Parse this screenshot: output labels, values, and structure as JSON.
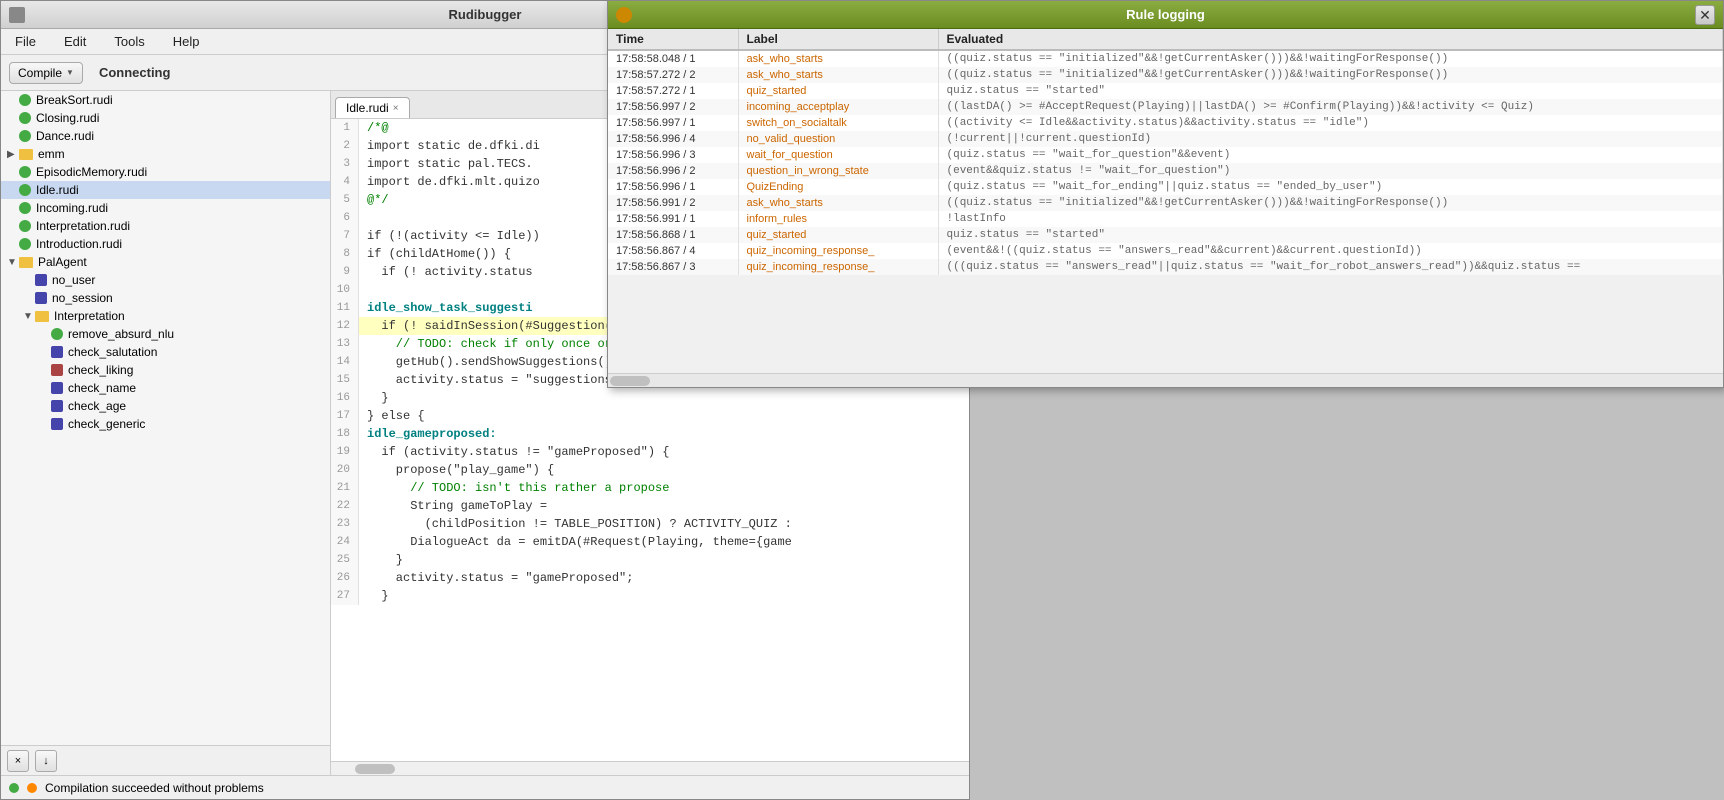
{
  "mainWindow": {
    "title": "Rudibugger",
    "menu": [
      "File",
      "Edit",
      "Tools",
      "Help"
    ],
    "toolbar": {
      "compile_label": "Compile",
      "connecting_label": "Connecting"
    }
  },
  "sidebar": {
    "items": [
      {
        "label": "BreakSort.rudi",
        "icon": "green",
        "indent": 0,
        "type": "file"
      },
      {
        "label": "Closing.rudi",
        "icon": "green",
        "indent": 0,
        "type": "file"
      },
      {
        "label": "Dance.rudi",
        "icon": "green",
        "indent": 0,
        "type": "file"
      },
      {
        "label": "emm",
        "icon": "folder",
        "indent": 0,
        "type": "folder",
        "expanded": false
      },
      {
        "label": "EpisodicMemory.rudi",
        "icon": "green",
        "indent": 0,
        "type": "file"
      },
      {
        "label": "Idle.rudi",
        "icon": "green",
        "indent": 0,
        "type": "file",
        "selected": true
      },
      {
        "label": "Incoming.rudi",
        "icon": "green",
        "indent": 0,
        "type": "file"
      },
      {
        "label": "Interpretation.rudi",
        "icon": "green",
        "indent": 0,
        "type": "file"
      },
      {
        "label": "Introduction.rudi",
        "icon": "green",
        "indent": 0,
        "type": "file"
      },
      {
        "label": "PalAgent",
        "icon": "folder",
        "indent": 0,
        "type": "folder",
        "expanded": true
      },
      {
        "label": "no_user",
        "icon": "blue-sq",
        "indent": 1,
        "type": "file"
      },
      {
        "label": "no_session",
        "icon": "blue-sq",
        "indent": 1,
        "type": "file"
      },
      {
        "label": "Interpretation",
        "icon": "folder",
        "indent": 1,
        "type": "folder",
        "expanded": true
      },
      {
        "label": "remove_absurd_nlu",
        "icon": "green",
        "indent": 2,
        "type": "file"
      },
      {
        "label": "check_salutation",
        "icon": "blue-sq",
        "indent": 2,
        "type": "file"
      },
      {
        "label": "check_liking",
        "icon": "red-sq",
        "indent": 2,
        "type": "file"
      },
      {
        "label": "check_name",
        "icon": "blue-sq",
        "indent": 2,
        "type": "file"
      },
      {
        "label": "check_age",
        "icon": "blue-sq",
        "indent": 2,
        "type": "file"
      },
      {
        "label": "check_generic",
        "icon": "blue-sq",
        "indent": 2,
        "type": "file"
      }
    ]
  },
  "editor": {
    "tab": "Idle.rudi",
    "lines": [
      {
        "num": 1,
        "content": "/*@",
        "cls": "c-comment",
        "highlight": false
      },
      {
        "num": 2,
        "content": "import static de.dfki.di",
        "cls": "c-normal",
        "highlight": false
      },
      {
        "num": 3,
        "content": "import static pal.TECS.",
        "cls": "c-normal",
        "highlight": false
      },
      {
        "num": 4,
        "content": "import de.dfki.mlt.quizo",
        "cls": "c-normal",
        "highlight": false
      },
      {
        "num": 5,
        "content": "@*/",
        "cls": "c-comment",
        "highlight": false
      },
      {
        "num": 6,
        "content": "",
        "cls": "c-normal",
        "highlight": false
      },
      {
        "num": 7,
        "content": "if (!(activity <= Idle))",
        "cls": "c-normal",
        "highlight": false
      },
      {
        "num": 8,
        "content": "if (childAtHome()) {",
        "cls": "c-normal",
        "highlight": false
      },
      {
        "num": 9,
        "content": "  if (! activity.status",
        "cls": "c-normal",
        "highlight": false
      },
      {
        "num": 10,
        "content": "",
        "cls": "c-normal",
        "highlight": false
      },
      {
        "num": 11,
        "content": "idle_show_task_suggesti",
        "cls": "c-label",
        "highlight": false
      },
      {
        "num": 12,
        "content": "  if (! saidInSession(#Suggestion(Task)) && activity.status",
        "cls": "c-normal",
        "highlight": true
      },
      {
        "num": 13,
        "content": "    // TODO: check if only once or every time you go to hom",
        "cls": "c-comment",
        "highlight": false
      },
      {
        "num": 14,
        "content": "    getHub().sendShowSuggestions();",
        "cls": "c-normal",
        "highlight": false
      },
      {
        "num": 15,
        "content": "    activity.status = \"suggestions_requested\";",
        "cls": "c-normal",
        "highlight": false
      },
      {
        "num": 16,
        "content": "  }",
        "cls": "c-normal",
        "highlight": false
      },
      {
        "num": 17,
        "content": "} else {",
        "cls": "c-normal",
        "highlight": false
      },
      {
        "num": 18,
        "content": "idle_gameproposed:",
        "cls": "c-label",
        "highlight": false
      },
      {
        "num": 19,
        "content": "  if (activity.status != \"gameProposed\") {",
        "cls": "c-normal",
        "highlight": false
      },
      {
        "num": 20,
        "content": "    propose(\"play_game\") {",
        "cls": "c-normal",
        "highlight": false
      },
      {
        "num": 21,
        "content": "      // TODO: isn't this rather a propose",
        "cls": "c-comment",
        "highlight": false
      },
      {
        "num": 22,
        "content": "      String gameToPlay =",
        "cls": "c-normal",
        "highlight": false
      },
      {
        "num": 23,
        "content": "        (childPosition != TABLE_POSITION) ? ACTIVITY_QUIZ :",
        "cls": "c-normal",
        "highlight": false
      },
      {
        "num": 24,
        "content": "      DialogueAct da = emitDA(#Request(Playing, theme={game",
        "cls": "c-normal",
        "highlight": false
      },
      {
        "num": 25,
        "content": "    }",
        "cls": "c-normal",
        "highlight": false
      },
      {
        "num": 26,
        "content": "    activity.status = \"gameProposed\";",
        "cls": "c-normal",
        "highlight": false
      },
      {
        "num": 27,
        "content": "  }",
        "cls": "c-normal",
        "highlight": false
      }
    ]
  },
  "statusBar": {
    "message": "Compilation succeeded without problems"
  },
  "ruleLogging": {
    "title": "Rule logging",
    "columns": [
      "Time",
      "Label",
      "Evaluated"
    ],
    "rows": [
      {
        "time": "17:58:58.048 / 1",
        "label": "ask_who_starts",
        "eval": "((quiz.status == \"initialized\"&&!getCurrentAsker()))&&!waitingForResponse())"
      },
      {
        "time": "17:58:57.272 / 2",
        "label": "ask_who_starts",
        "eval": "((quiz.status == \"initialized\"&&!getCurrentAsker()))&&!waitingForResponse())"
      },
      {
        "time": "17:58:57.272 / 1",
        "label": "quiz_started",
        "eval": "quiz.status == \"started\""
      },
      {
        "time": "17:58:56.997 / 2",
        "label": "incoming_acceptplay",
        "eval": "((lastDA() >= #AcceptRequest(Playing)||lastDA() >= #Confirm(Playing))&&!activity <= Quiz)"
      },
      {
        "time": "17:58:56.997 / 1",
        "label": "switch_on_socialtalk",
        "eval": "((activity <= Idle&&activity.status)&&activity.status == \"idle\")"
      },
      {
        "time": "17:58:56.996 / 4",
        "label": "no_valid_question",
        "eval": "(!current||!current.questionId)"
      },
      {
        "time": "17:58:56.996 / 3",
        "label": "wait_for_question",
        "eval": "(quiz.status == \"wait_for_question\"&&event)"
      },
      {
        "time": "17:58:56.996 / 2",
        "label": "question_in_wrong_state",
        "eval": "(event&&quiz.status != \"wait_for_question\")"
      },
      {
        "time": "17:58:56.996 / 1",
        "label": "QuizEnding",
        "eval": "(quiz.status == \"wait_for_ending\"||quiz.status == \"ended_by_user\")"
      },
      {
        "time": "17:58:56.991 / 2",
        "label": "ask_who_starts",
        "eval": "((quiz.status == \"initialized\"&&!getCurrentAsker()))&&!waitingForResponse())"
      },
      {
        "time": "17:58:56.991 / 1",
        "label": "inform_rules",
        "eval": "!lastInfo"
      },
      {
        "time": "17:58:56.868 / 1",
        "label": "quiz_started",
        "eval": "quiz.status == \"started\""
      },
      {
        "time": "17:58:56.867 / 4",
        "label": "quiz_incoming_response_",
        "eval": "(event&&!((quiz.status == \"answers_read\"&&current)&&current.questionId))"
      },
      {
        "time": "17:58:56.867 / 3",
        "label": "quiz_incoming_response_",
        "eval": "(((quiz.status == \"answers_read\"||quiz.status == \"wait_for_robot_answers_read\"))&&quiz.status =="
      }
    ]
  }
}
